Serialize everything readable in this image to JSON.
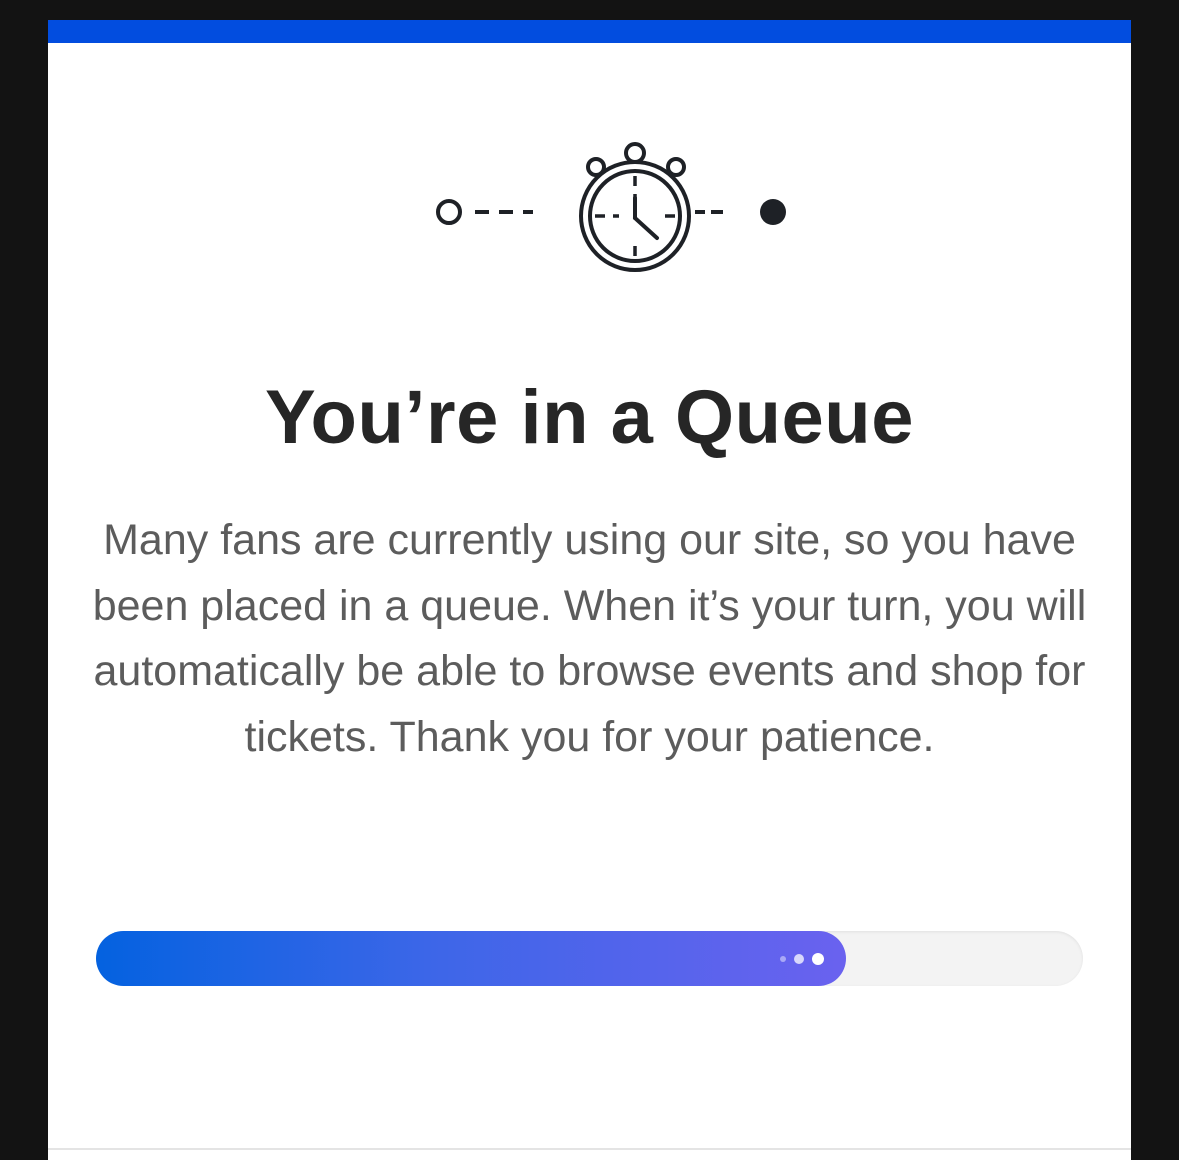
{
  "modal": {
    "accent_color": "#024ddf",
    "illustration_icon": "queue-stopwatch-icon",
    "title": "You’re in a Queue",
    "message": "Many fans are currently using our site, so you have been placed in a queue. When it’s your turn, you will automatically be able to browse events and shop for tickets. Thank you for your patience.",
    "progress": {
      "fraction": 0.76,
      "fill_gradient_start": "#0462e0",
      "fill_gradient_end": "#6a62ef",
      "indicator_icon": "loading-dots-icon"
    }
  }
}
